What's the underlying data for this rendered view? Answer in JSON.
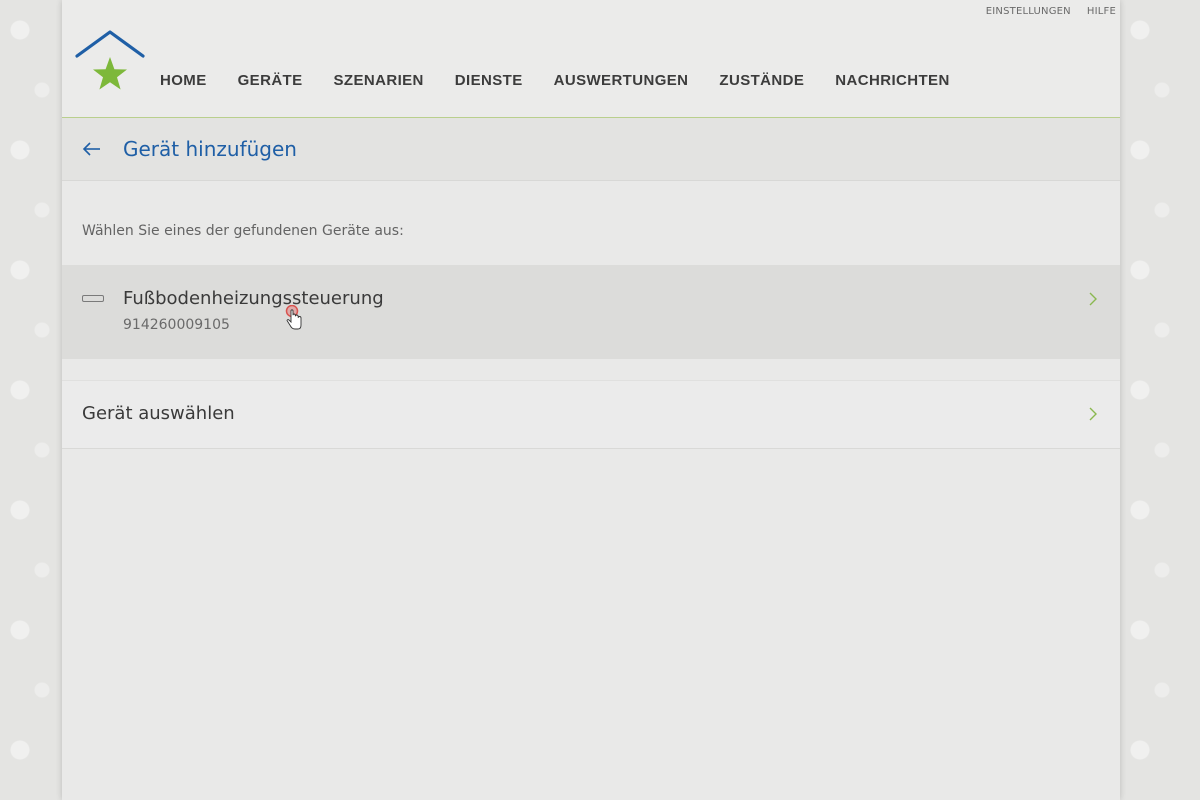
{
  "header": {
    "top_links": [
      "EINSTELLUNGEN",
      "HILFE"
    ],
    "nav": [
      "HOME",
      "GERÄTE",
      "SZENARIEN",
      "DIENSTE",
      "AUSWERTUNGEN",
      "ZUSTÄNDE",
      "NACHRICHTEN"
    ]
  },
  "title_bar": {
    "title": "Gerät hinzufügen"
  },
  "main": {
    "instruction": "Wählen Sie eines der gefundenen Geräte aus:",
    "found_device": {
      "name": "Fußbodenheizungssteuerung",
      "serial": "914260009105"
    },
    "select_device_label": "Gerät auswählen"
  },
  "colors": {
    "accent_blue": "#1f5fa6",
    "accent_green": "#7db83a",
    "chevron_green": "#8ab850"
  },
  "icons": [
    "house-star-logo",
    "back-arrow-icon",
    "device-icon",
    "chevron-right-icon",
    "pointer-cursor-icon"
  ]
}
